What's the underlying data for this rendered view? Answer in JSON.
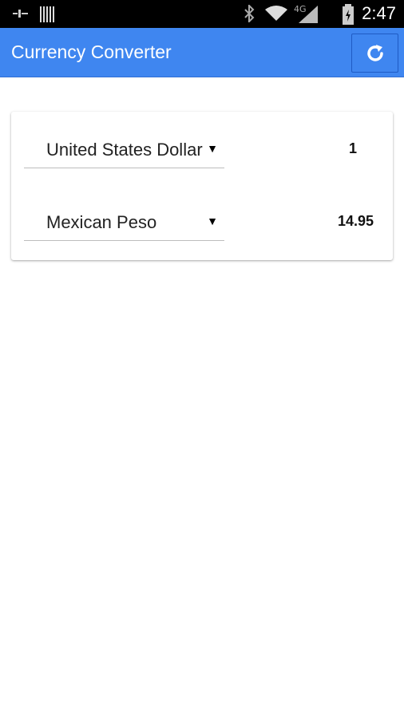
{
  "status_bar": {
    "time": "2:47",
    "icons": [
      "signal-strength-icon",
      "barcode-icon",
      "bluetooth-icon",
      "wifi-icon",
      "4g-icon",
      "cell-signal-icon",
      "battery-charging-icon"
    ]
  },
  "app_bar": {
    "title": "Currency Converter",
    "refresh_icon": "refresh-icon",
    "color": "#3f86f0"
  },
  "converter": {
    "from": {
      "currency": "United States Dollar",
      "amount": "1"
    },
    "to": {
      "currency": "Mexican Peso",
      "amount": "14.95"
    }
  }
}
